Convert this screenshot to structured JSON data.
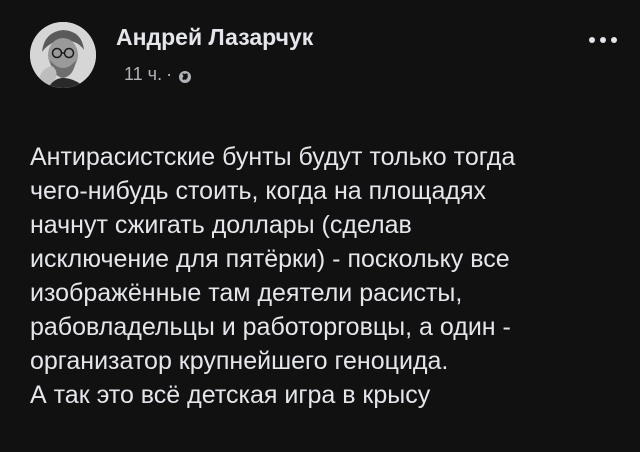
{
  "post": {
    "author": {
      "name": "Андрей Лазарчук",
      "avatar_icon": "user-photo-avatar"
    },
    "meta": {
      "time": "11 ч.",
      "separator": "·",
      "privacy_icon": "globe-icon"
    },
    "more_icon": "more-horizontal-icon",
    "text_lines": [
      "Антирасистские бунты будут только тогда",
      "чего-нибудь стоить, когда на площадях",
      "начнут сжигать доллары (сделав",
      "исключение для пятёрки) - поскольку все",
      "изображённые там деятели расисты,",
      "рабовладельцы и работорговцы, а один -",
      "организатор крупнейшего геноцида.",
      "А так это всё детская игра в крысу"
    ]
  },
  "colors": {
    "background": "#111111",
    "text_primary": "#e4e6eb",
    "text_secondary": "#b0b3b8"
  }
}
